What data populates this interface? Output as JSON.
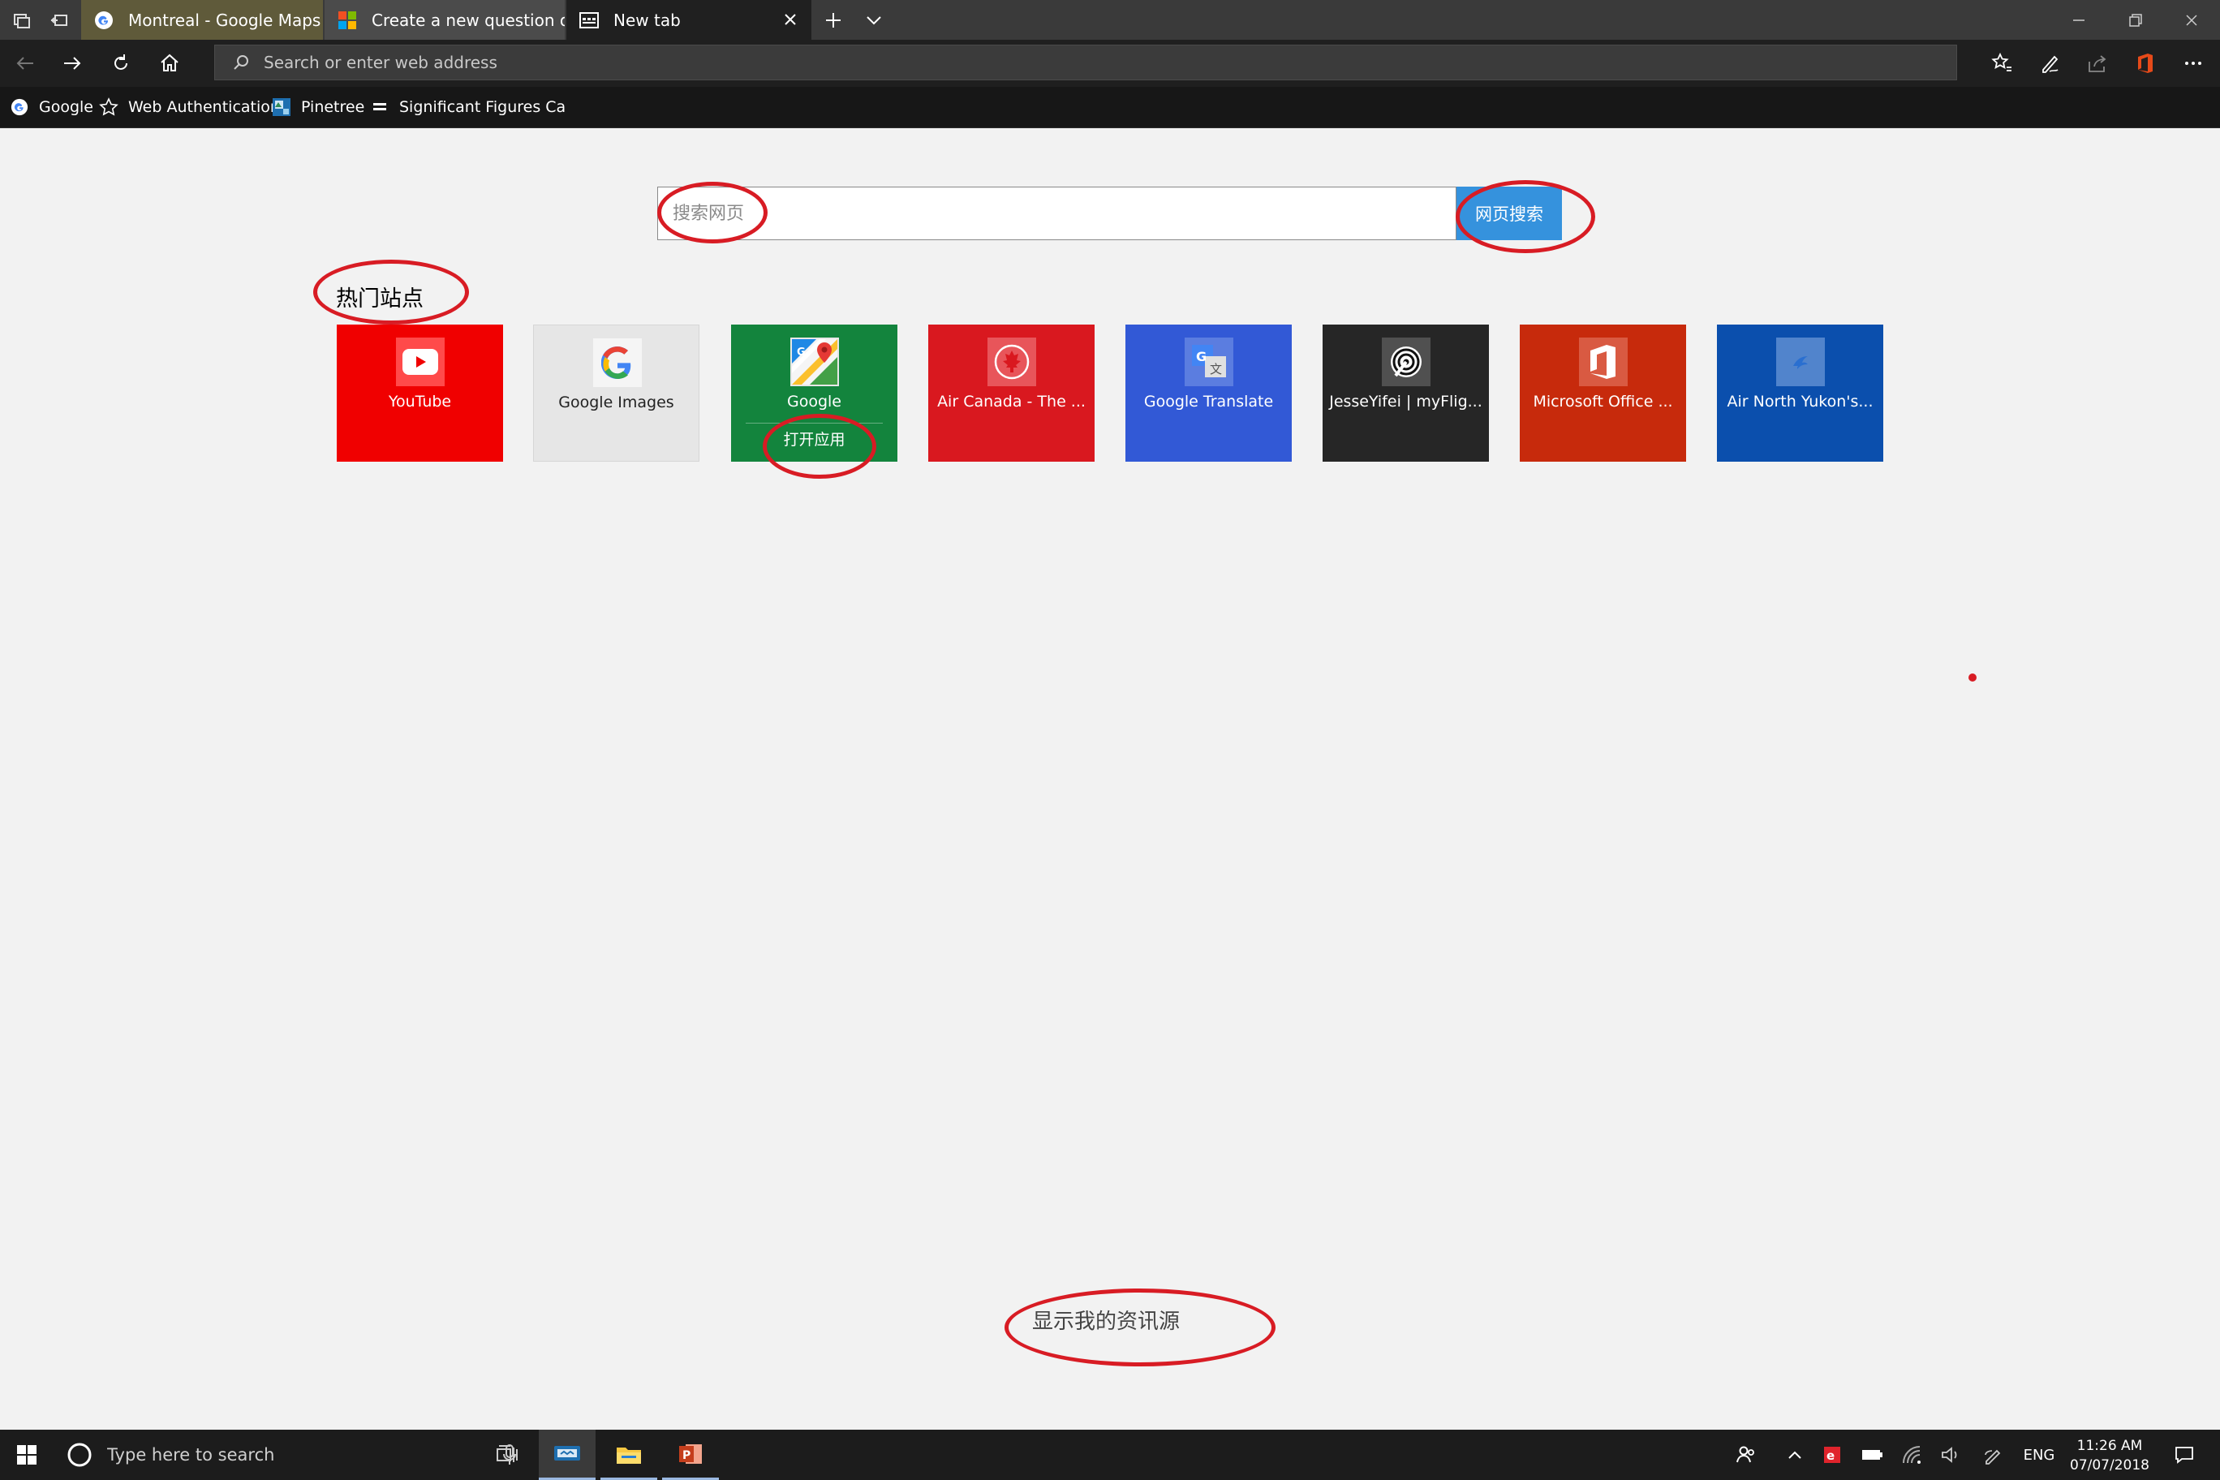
{
  "tabs": [
    {
      "label": "Montreal - Google Maps",
      "icon": "google-g-icon"
    },
    {
      "label": "Create a new question or st",
      "icon": "microsoft-logo-icon"
    },
    {
      "label": "New tab",
      "icon": "new-tab-page-icon",
      "active": true
    }
  ],
  "address_bar": {
    "placeholder": "Search or enter web address"
  },
  "favorites": [
    {
      "label": "Google",
      "icon": "google-g-icon"
    },
    {
      "label": "Web Authentication",
      "icon": "star-icon"
    },
    {
      "label": "Pinetree",
      "icon": "pinetree-icon"
    },
    {
      "label": "Significant Figures Ca",
      "icon": "calculator-icon"
    }
  ],
  "search": {
    "placeholder": "搜索网页",
    "button_label": "网页搜索"
  },
  "top_sites": {
    "title": "热门站点",
    "tiles": [
      {
        "label": "YouTube",
        "color": "#f00000",
        "icon": "youtube-icon"
      },
      {
        "label": "Google Images",
        "color": "#e6e6e6",
        "icon": "google-g-icon"
      },
      {
        "label": "Google",
        "color": "#13843d",
        "icon": "google-maps-icon",
        "action": "打开应用"
      },
      {
        "label": "Air Canada - The ...",
        "color": "#d9181f",
        "icon": "maple-leaf-icon"
      },
      {
        "label": "Google Translate",
        "color": "#3259d6",
        "icon": "translate-icon"
      },
      {
        "label": "JesseYifei | myFlig...",
        "color": "#262626",
        "icon": "spiral-icon"
      },
      {
        "label": "Microsoft Office ...",
        "color": "#c72a0c",
        "icon": "office-icon"
      },
      {
        "label": "Air North Yukon's...",
        "color": "#0b4fad",
        "icon": "bird-icon"
      }
    ]
  },
  "news": {
    "link_label": "显示我的资讯源"
  },
  "taskbar": {
    "search_placeholder": "Type here to search",
    "language": "ENG",
    "time": "11:26 AM",
    "date": "07/07/2018"
  },
  "colors": {
    "annotation": "#d81c24",
    "search_button": "#3592dd"
  }
}
